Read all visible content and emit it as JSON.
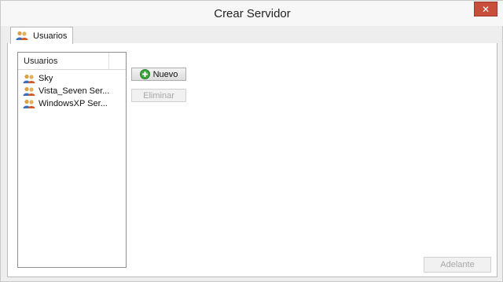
{
  "window": {
    "title": "Crear Servidor",
    "close_symbol": "✕"
  },
  "tabs": [
    {
      "label": "Usuarios",
      "icon": "users-icon",
      "selected": true
    }
  ],
  "user_list": {
    "header": "Usuarios",
    "items": [
      {
        "label": "Sky",
        "icon": "users-icon"
      },
      {
        "label": "Vista_Seven Ser...",
        "icon": "users-icon"
      },
      {
        "label": "WindowsXP Ser...",
        "icon": "users-icon"
      }
    ]
  },
  "buttons": {
    "nuevo": {
      "label": "Nuevo",
      "icon": "add-icon",
      "enabled": true
    },
    "eliminar": {
      "label": "Eliminar",
      "enabled": false
    },
    "adelante": {
      "label": "Adelante",
      "enabled": false
    }
  },
  "colors": {
    "close_button": "#c74e3b",
    "add_icon": "#3aa63a"
  }
}
